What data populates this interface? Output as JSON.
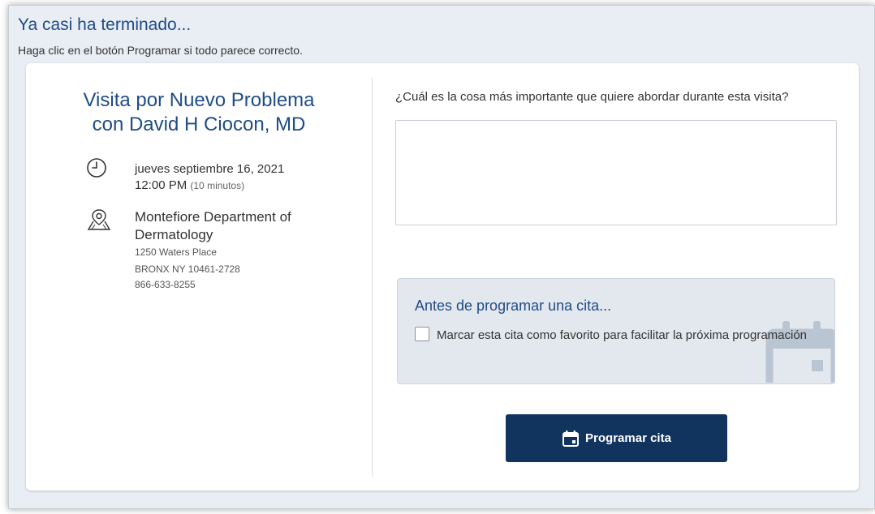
{
  "header": {
    "title": "Ya casi ha terminado...",
    "subtitle": "Haga clic en el botón Programar si todo parece correcto."
  },
  "visit": {
    "title_line1": "Visita por Nuevo Problema",
    "title_line2": "con David H Ciocon, MD",
    "date": "jueves septiembre 16, 2021",
    "time": "12:00 PM",
    "duration": "(10 minutos)",
    "location_name": "Montefiore Department of Dermatology",
    "address_line1": "1250 Waters Place",
    "address_line2": "BRONX NY 10461-2728",
    "phone": "866-633-8255",
    "icons": {
      "time": "clock-icon",
      "location": "map-pin-icon"
    }
  },
  "question": {
    "label": "¿Cuál es la cosa más importante que quiere abordar durante esta visita?",
    "value": "",
    "placeholder": ""
  },
  "favorite": {
    "title": "Antes de programar una cita...",
    "checkbox_label": "Marcar esta cita como favorito para facilitar la próxima programación",
    "checked": false
  },
  "schedule_button": {
    "label": "Programar cita",
    "icon": "calendar-icon"
  },
  "colors": {
    "accent": "#1f4c85",
    "button": "#11345f",
    "page_bg": "#e9eef4"
  }
}
